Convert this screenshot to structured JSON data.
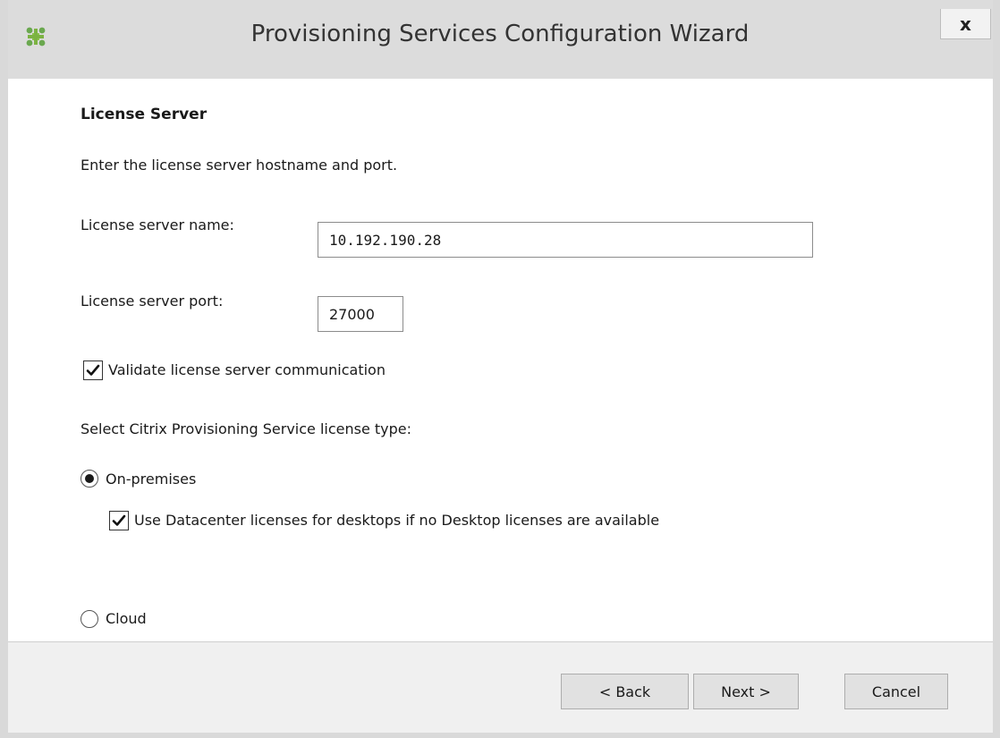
{
  "window": {
    "title": "Provisioning Services Configuration Wizard",
    "close_label": "x",
    "app_icon": "citrix-icon"
  },
  "page": {
    "heading": "License Server",
    "instructions": "Enter the license server hostname and port."
  },
  "license_server_name": {
    "label": "License server name:",
    "value": "10.192.190.28"
  },
  "license_server_port": {
    "label": "License server port:",
    "value": "27000"
  },
  "validate_communication": {
    "label": "Validate license server communication",
    "checked": true
  },
  "license_type": {
    "label": "Select Citrix Provisioning Service license type:",
    "options": [
      {
        "label": "On-premises",
        "selected": true
      },
      {
        "label": "Cloud",
        "selected": false
      }
    ],
    "datacenter_option": {
      "label": "Use Datacenter licenses for desktops if no Desktop licenses are available",
      "checked": true
    }
  },
  "buttons": {
    "back": "< Back",
    "next": "Next >",
    "cancel": "Cancel"
  }
}
